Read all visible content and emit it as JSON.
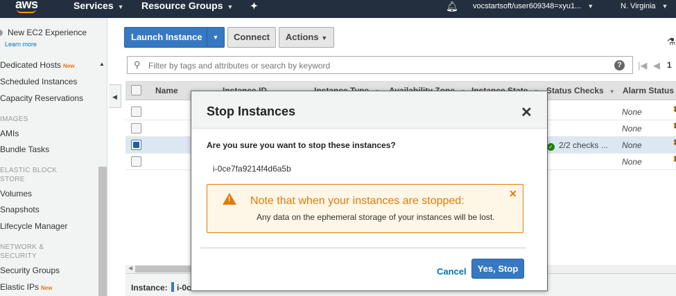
{
  "topnav": {
    "logo": "aws",
    "services": "Services",
    "resource_groups": "Resource Groups",
    "pin_icon": "pin-icon",
    "bell_icon": "bell-icon",
    "account": "vocstartsoft/user609348=xyu1...",
    "region": "N. Virginia"
  },
  "sidebar": {
    "experience": "New EC2 Experience",
    "learn_more": "Learn more",
    "links": {
      "dedicated_hosts": "Dedicated Hosts",
      "scheduled_instances": "Scheduled Instances",
      "capacity_reservations": "Capacity Reservations",
      "amis": "AMIs",
      "bundle_tasks": "Bundle Tasks",
      "volumes": "Volumes",
      "snapshots": "Snapshots",
      "lifecycle_manager": "Lifecycle Manager",
      "security_groups": "Security Groups",
      "elastic_ips": "Elastic IPs"
    },
    "new_badge": "New",
    "sections": {
      "images": "IMAGES",
      "ebs": "ELASTIC BLOCK STORE",
      "network": "NETWORK & SECURITY"
    }
  },
  "toolbar": {
    "launch": "Launch Instance",
    "connect": "Connect",
    "actions": "Actions"
  },
  "filter": {
    "placeholder": "Filter by tags and attributes or search by keyword",
    "help": "?",
    "page_text": "1"
  },
  "table": {
    "columns": [
      "Name",
      "Instance ID",
      "Instance Type",
      "Availability Zone",
      "Instance State",
      "Status Checks",
      "Alarm Status"
    ],
    "rows": [
      {
        "alarm": "None",
        "status": "",
        "selected": false
      },
      {
        "alarm": "None",
        "status": "",
        "selected": false
      },
      {
        "alarm": "None",
        "status": "2/2 checks ...",
        "selected": true
      },
      {
        "alarm": "None",
        "status": "",
        "selected": false
      }
    ]
  },
  "bottom": {
    "label": "Instance:",
    "value": "i-0c"
  },
  "modal": {
    "title": "Stop Instances",
    "question": "Are you sure you want to stop these instances?",
    "instance_id": "i-0ce7fa9214f4d6a5b",
    "warning_title": "Note that when your instances are stopped:",
    "warning_text": "Any data on the ephemeral storage of your instances will be lost.",
    "cancel": "Cancel",
    "confirm": "Yes, Stop"
  },
  "colors": {
    "nav_bg": "#232f3e",
    "primary": "#3778c2",
    "warning": "#e07b0a",
    "link": "#0073bb"
  }
}
